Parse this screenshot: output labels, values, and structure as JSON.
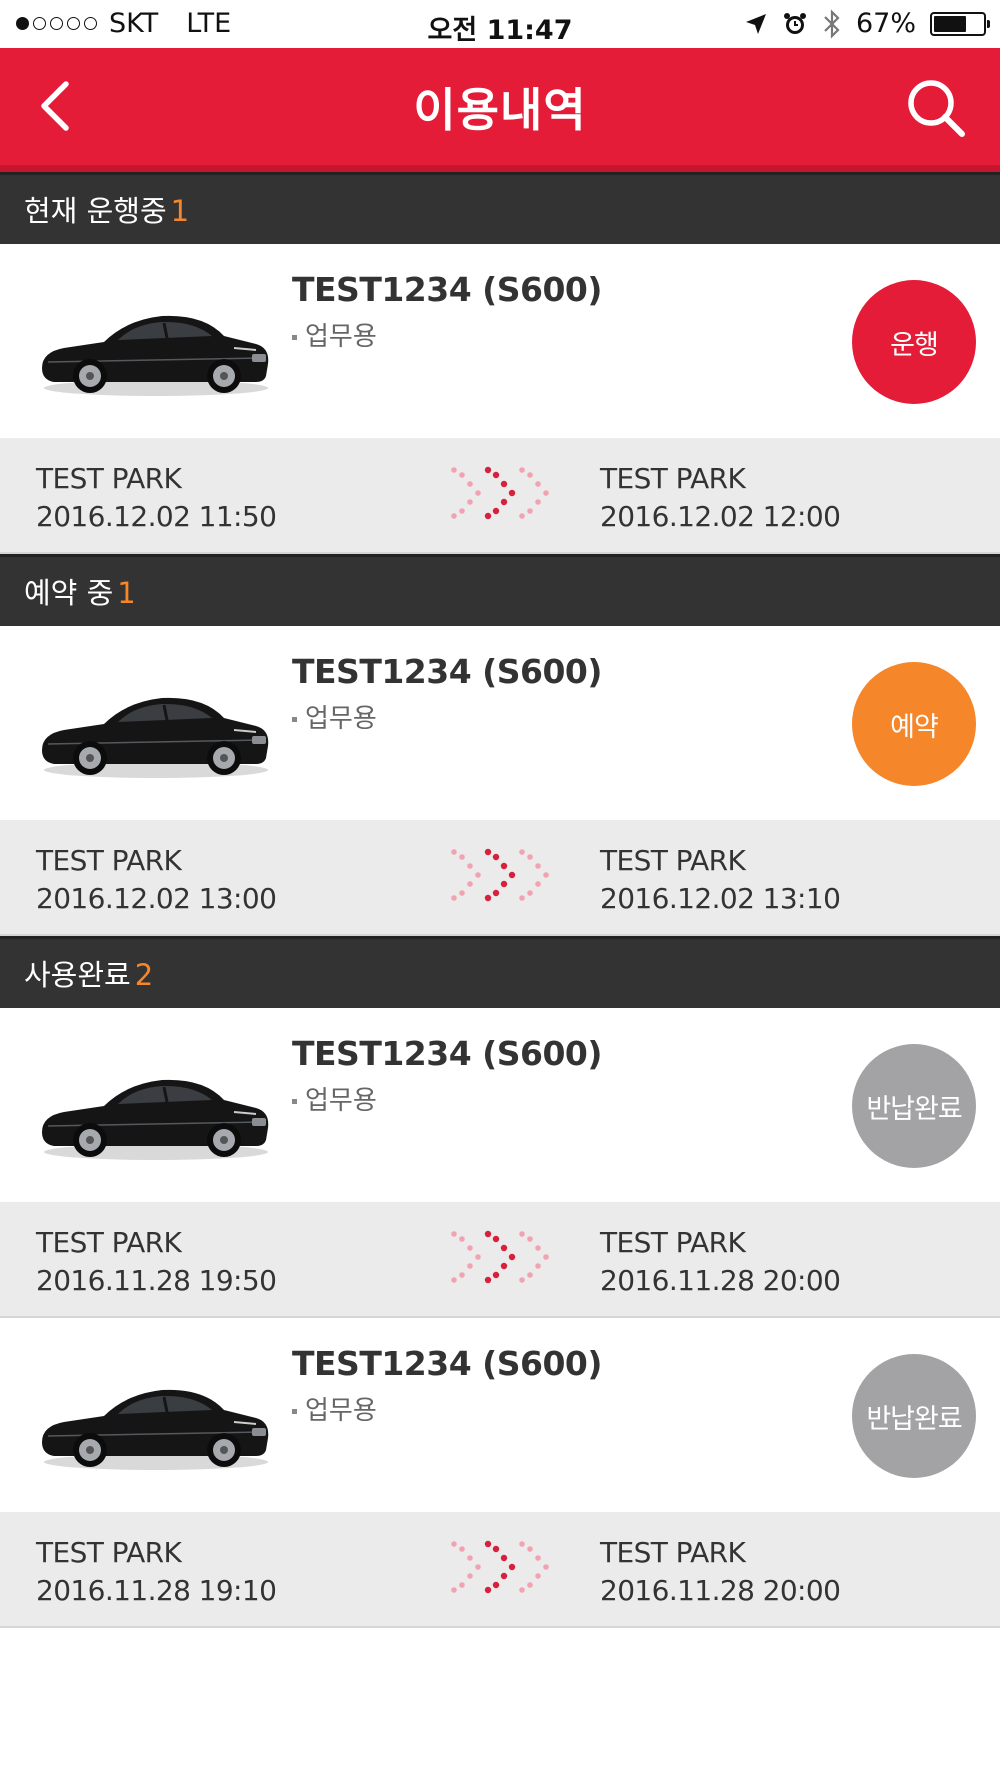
{
  "status_bar": {
    "carrier": "SKT",
    "network": "LTE",
    "time": "오전 11:47",
    "battery": "67%",
    "battery_level": 0.67,
    "signal_filled": 1,
    "signal_total": 5,
    "icons": [
      "location-arrow-icon",
      "alarm-icon",
      "bluetooth-icon",
      "battery-icon"
    ]
  },
  "header": {
    "title": "이용내역",
    "back_icon": "chevron-left-icon",
    "search_icon": "search-icon",
    "background_color": "#e41c38"
  },
  "sections": [
    {
      "label": "현재 운행중",
      "count": "1",
      "items": [
        {
          "model": "TEST1234 (S600)",
          "usage": "업무용",
          "badge": "운행",
          "badge_color": "#e41c38",
          "from_place": "TEST PARK",
          "from_time": "2016.12.02 11:50",
          "to_place": "TEST PARK",
          "to_time": "2016.12.02 12:00"
        }
      ]
    },
    {
      "label": "예약 중",
      "count": "1",
      "items": [
        {
          "model": "TEST1234 (S600)",
          "usage": "업무용",
          "badge": "예약",
          "badge_color": "#f5862a",
          "from_place": "TEST PARK",
          "from_time": "2016.12.02 13:00",
          "to_place": "TEST PARK",
          "to_time": "2016.12.02 13:10"
        }
      ]
    },
    {
      "label": "사용완료",
      "count": "2",
      "items": [
        {
          "model": "TEST1234 (S600)",
          "usage": "업무용",
          "badge": "반납완료",
          "badge_color": "#a3a3a6",
          "from_place": "TEST PARK",
          "from_time": "2016.11.28 19:50",
          "to_place": "TEST PARK",
          "to_time": "2016.11.28 20:00"
        },
        {
          "model": "TEST1234 (S600)",
          "usage": "업무용",
          "badge": "반납완료",
          "badge_color": "#a3a3a6",
          "from_place": "TEST PARK",
          "from_time": "2016.11.28 19:10",
          "to_place": "TEST PARK",
          "to_time": "2016.11.28 20:00"
        }
      ]
    }
  ]
}
